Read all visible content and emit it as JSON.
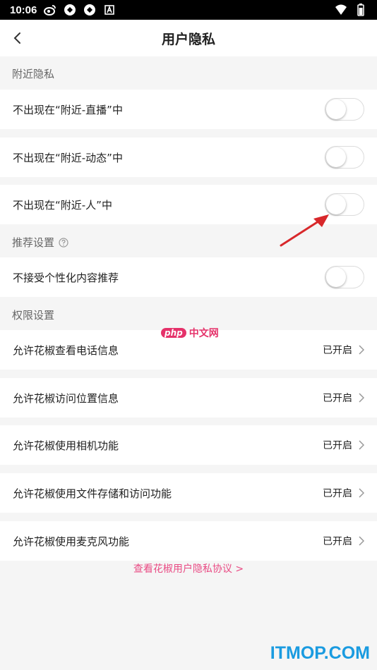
{
  "status_bar": {
    "time": "10:06"
  },
  "header": {
    "title": "用户隐私"
  },
  "sections": {
    "nearby": {
      "label": "附近隐私",
      "items": [
        {
          "label": "不出现在“附近-直播”中",
          "enabled": false
        },
        {
          "label": "不出现在“附近-动态”中",
          "enabled": false
        },
        {
          "label": "不出现在“附近-人”中",
          "enabled": false
        }
      ]
    },
    "recommend": {
      "label": "推荐设置",
      "items": [
        {
          "label": "不接受个性化内容推荐",
          "enabled": false
        }
      ]
    },
    "permissions": {
      "label": "权限设置",
      "items": [
        {
          "label": "允许花椒查看电话信息",
          "status": "已开启"
        },
        {
          "label": "允许花椒访问位置信息",
          "status": "已开启"
        },
        {
          "label": "允许花椒使用相机功能",
          "status": "已开启"
        },
        {
          "label": "允许花椒使用文件存储和访问功能",
          "status": "已开启"
        },
        {
          "label": "允许花椒使用麦克风功能",
          "status": "已开启"
        }
      ]
    }
  },
  "footer": {
    "policy_link": "查看花椒用户隐私协议 >"
  },
  "watermarks": {
    "php_badge": "php",
    "php_text": "中文网",
    "site": "ITMOP.COM"
  },
  "colors": {
    "accent_pink": "#e94b84",
    "watermark_blue": "#1a9be0",
    "arrow_red": "#d8282b"
  }
}
